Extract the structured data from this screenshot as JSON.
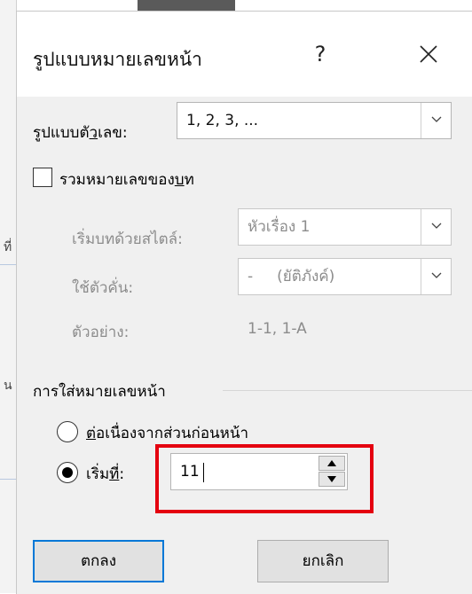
{
  "dialog": {
    "title": "รูปแบบหมายเลขหน้า",
    "help": "?",
    "close": "✕"
  },
  "number_format": {
    "label_pre": "รูปแบบตั",
    "label_accel": "ว",
    "label_post": "เลข:",
    "value": "1, 2, 3, ..."
  },
  "include_chapter": {
    "label_pre": "รวมหมายเลขของ",
    "label_accel": "บ",
    "label_post": "ท",
    "checked": false,
    "chapter_style_label": "เริ่มบทด้วยสไตล์:",
    "chapter_style_value": "หัวเรื่อง 1",
    "separator_label": "ใช้ตัวคั่น:",
    "separator_value": "-     (ยัติภังค์)",
    "example_label": "ตัวอย่าง:",
    "example_value": "1-1, 1-A"
  },
  "page_numbering": {
    "group_label": "การใส่หมายเลขหน้า",
    "continue_pre": "",
    "continue_accel": "ต",
    "continue_post": "่อเนื่องจากส่วนก่อนหน้า",
    "start_pre": "เริ่ม",
    "start_accel": "ที",
    "start_post": "่:",
    "start_value": "11",
    "selected": "start"
  },
  "buttons": {
    "ok": "ตกลง",
    "cancel": "ยกเลิก"
  },
  "colors": {
    "highlight_border": "#e4000f",
    "default_button_border": "#0078d7"
  }
}
